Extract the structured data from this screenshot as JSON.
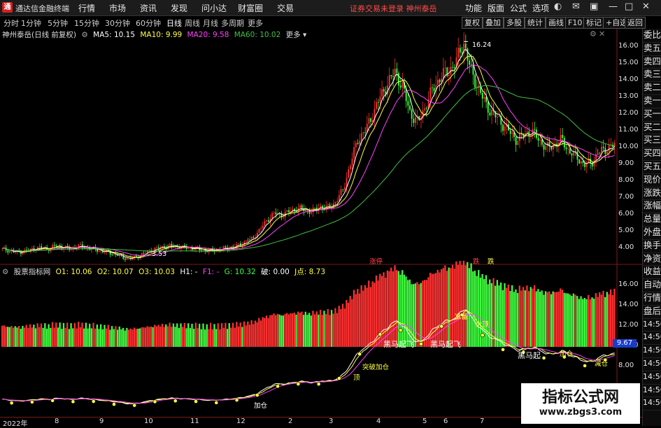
{
  "menubar": {
    "app_name": "通达信金融终端",
    "menus": [
      "行情",
      "市场",
      "资讯",
      "发现",
      "问小达",
      "财富圈",
      "交易"
    ],
    "notice": "证券交易未登录  神州泰岳",
    "right_menus": [
      "功能",
      "版面",
      "公式",
      "选项"
    ]
  },
  "periods": {
    "items": [
      "分时",
      "1分钟",
      "5分钟",
      "15分钟",
      "30分钟",
      "60分钟",
      "日线",
      "周线",
      "月线",
      "多周期",
      "更多"
    ],
    "active": "日线",
    "right_buttons": [
      "复权",
      "叠加",
      "多股",
      "统计",
      "画线",
      "F10",
      "标记",
      "+自选",
      "返回"
    ]
  },
  "main_info": {
    "title": "神州泰岳(日线 前复权)",
    "ma5": "MA5: 10.15",
    "ma10": "MA10: 9.99",
    "ma20": "MA20: 9.58",
    "ma60": "MA60: 10.02"
  },
  "sub_info": {
    "title": "股票指标网",
    "o1": "O1: 10.06",
    "o2": "O2: 10.07",
    "o3": "O3: 10.03",
    "h1": "H1: -",
    "f1": "F1: -",
    "g": "G: 10.32",
    "po": "破: 0.00",
    "j": "J点: 8.73"
  },
  "right_column": [
    "委比",
    "卖五",
    "卖四",
    "卖三",
    "卖二",
    "卖一",
    "买一",
    "买二",
    "买三",
    "买四",
    "买五",
    "现价",
    "涨跌",
    "涨幅",
    "总量",
    "外盘",
    "换手",
    "净资",
    "收益",
    "自动",
    "行情",
    "盘后",
    "14:56",
    "14:56",
    "14:56",
    "14:56",
    "14:56",
    "14:56",
    "14:56"
  ],
  "colors": {
    "up": "#ff3030",
    "down": "#40ff40",
    "ma5": "#ffffff",
    "ma10": "#ffff40",
    "ma20": "#ff40ff",
    "ma60": "#40c040"
  },
  "main_axis": [
    "16.00",
    "15.00",
    "14.00",
    "13.00",
    "12.00",
    "11.00",
    "10.00",
    "9.00",
    "8.00",
    "7.00",
    "6.00",
    "5.00",
    "4.00"
  ],
  "sub_axis": [
    "16.00",
    "14.00",
    "12.00",
    "10.00",
    "8.00"
  ],
  "sub_current": "9.67",
  "high_label": "16.24",
  "low_label": "3.53",
  "event_labels": [
    "涨停",
    "跌",
    "跌"
  ],
  "x_labels": [
    "2022年",
    "8",
    "9",
    "10",
    "11",
    "12",
    "2",
    "3",
    "4",
    "5",
    "6",
    "7"
  ],
  "signal_labels": [
    "黑马起飞",
    "黑马起飞",
    "突破加仓",
    "黑马起",
    "加仓",
    "准备",
    "大顶",
    "顶",
    "减仓",
    "加仓"
  ],
  "watermark": {
    "title": "指标公式网",
    "url": "www.zbgs3.com"
  },
  "chart_data": {
    "type": "candlestick",
    "title": "神州泰岳(日线 前复权)",
    "ylim": [
      3.5,
      16.5
    ],
    "x_ticks": [
      "2022年",
      "8",
      "9",
      "10",
      "11",
      "12",
      "2",
      "3",
      "4",
      "5",
      "6",
      "7"
    ],
    "series": [
      {
        "name": "MA5",
        "value": 10.15
      },
      {
        "name": "MA10",
        "value": 9.99
      },
      {
        "name": "MA20",
        "value": 9.58
      },
      {
        "name": "MA60",
        "value": 10.02
      }
    ],
    "price_path": [
      4.1,
      4.0,
      3.9,
      4.0,
      4.1,
      4.2,
      4.1,
      4.3,
      4.2,
      4.1,
      4.3,
      4.2,
      4.1,
      4.0,
      3.9,
      3.8,
      3.6,
      3.55,
      3.7,
      3.9,
      4.1,
      4.2,
      4.3,
      4.25,
      4.2,
      4.15,
      4.1,
      4.0,
      4.05,
      4.1,
      4.2,
      4.3,
      4.5,
      4.7,
      5.2,
      5.8,
      6.2,
      6.1,
      6.3,
      6.5,
      6.4,
      6.3,
      6.6,
      6.5,
      6.8,
      7.5,
      9.0,
      10.5,
      11.0,
      12.0,
      13.0,
      13.8,
      14.5,
      13.5,
      12.0,
      11.5,
      12.5,
      13.5,
      14.2,
      14.5,
      15.0,
      16.24,
      14.5,
      13.5,
      12.5,
      12.0,
      11.5,
      11.0,
      10.5,
      10.8,
      11.0,
      10.5,
      10.0,
      10.2,
      10.5,
      9.8,
      9.5,
      9.0,
      9.2,
      9.8,
      10.0,
      10.2
    ]
  }
}
